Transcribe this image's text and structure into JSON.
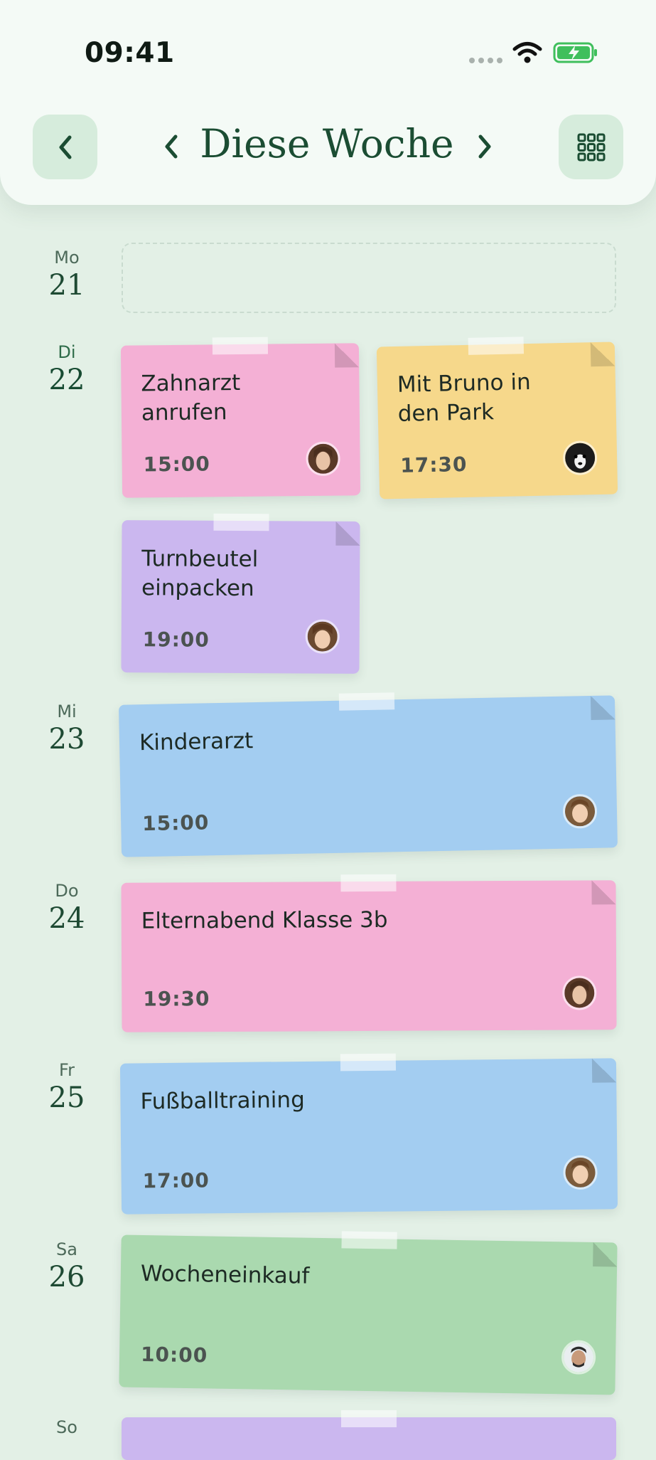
{
  "status": {
    "time": "09:41"
  },
  "header": {
    "title": "Diese Woche",
    "back_icon": "chevron-left-icon",
    "prev_icon": "chevron-left-icon",
    "next_icon": "chevron-right-icon",
    "menu_icon": "grid-icon"
  },
  "days": [
    {
      "name": "Mo",
      "date": "21"
    },
    {
      "name": "Di",
      "date": "22"
    },
    {
      "name": "Mi",
      "date": "23"
    },
    {
      "name": "Do",
      "date": "24"
    },
    {
      "name": "Fr",
      "date": "25"
    },
    {
      "name": "Sa",
      "date": "26"
    },
    {
      "name": "So",
      "date": ""
    }
  ],
  "notes": [
    {
      "title": "Zahnarzt anrufen",
      "time": "15:00",
      "color": "#f4b0d5",
      "avatar": "girl-avatar"
    },
    {
      "title": "Mit Bruno in den Park",
      "time": "17:30",
      "color": "#f6d88b",
      "avatar": "dog-avatar"
    },
    {
      "title": "Turnbeutel einpacken",
      "time": "19:00",
      "color": "#cbb7ef",
      "avatar": "child-avatar"
    },
    {
      "title": "Kinderarzt",
      "time": "15:00",
      "color": "#a3cdf1",
      "avatar": "boy-avatar"
    },
    {
      "title": "Elternabend Klasse 3b",
      "time": "19:30",
      "color": "#f4b0d5",
      "avatar": "girl-avatar"
    },
    {
      "title": "Fußballtraining",
      "time": "17:00",
      "color": "#a3cdf1",
      "avatar": "boy-avatar"
    },
    {
      "title": "Wocheneinkauf",
      "time": "10:00",
      "color": "#aad9af",
      "avatar": "man-avatar"
    }
  ]
}
